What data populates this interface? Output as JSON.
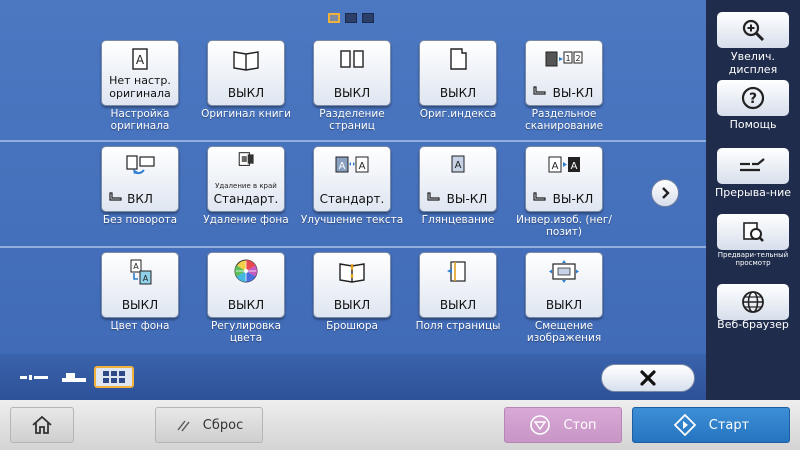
{
  "colors": {
    "accent": "#f0b23c",
    "panel": "#3f69b5",
    "sidebar": "#1f2c4b",
    "start": "#2574c0",
    "stop": "#c796c6"
  },
  "pagination": {
    "total": 3,
    "current": 1
  },
  "functions": [
    {
      "id": "original-settings",
      "icon": "original-doc-icon",
      "value": "Нет настр. оригинала",
      "label": "Настройка оригинала"
    },
    {
      "id": "book-original",
      "icon": "book-icon",
      "value": "ВЫКЛ",
      "label": "Оригинал книги"
    },
    {
      "id": "page-separation",
      "icon": "split-pages-icon",
      "value": "ВЫКЛ",
      "label": "Разделение страниц"
    },
    {
      "id": "index-original",
      "icon": "index-doc-icon",
      "value": "ВЫКЛ",
      "label": "Ориг.индекса"
    },
    {
      "id": "separate-scan",
      "icon": "separate-scan-icon",
      "value": "ВЫ-КЛ",
      "label": "Раздельное сканирование"
    },
    {
      "id": "no-rotation",
      "icon": "rotation-icon",
      "value": "ВКЛ",
      "label": "Без поворота"
    },
    {
      "id": "bg-removal",
      "icon": "bg-removal-icon",
      "sub": "Удаление в край",
      "value": "Стандарт.",
      "label": "Удаление фона"
    },
    {
      "id": "text-enhance",
      "icon": "text-enhance-icon",
      "value": "Стандарт.",
      "label": "Улучшение текста"
    },
    {
      "id": "glossy",
      "icon": "glossy-icon",
      "value": "ВЫ-КЛ",
      "label": "Глянцевание"
    },
    {
      "id": "invert-image",
      "icon": "invert-icon",
      "value": "ВЫ-КЛ",
      "label": "Инвер.изоб. (нег/позит)"
    },
    {
      "id": "bg-color",
      "icon": "bg-color-icon",
      "value": "ВЫКЛ",
      "label": "Цвет фона"
    },
    {
      "id": "color-adjust",
      "icon": "color-wheel-icon",
      "value": "ВЫКЛ",
      "label": "Регулировка цвета"
    },
    {
      "id": "booklet",
      "icon": "booklet-icon",
      "value": "ВЫКЛ",
      "label": "Брошюра"
    },
    {
      "id": "page-margin",
      "icon": "margin-icon",
      "value": "ВЫКЛ",
      "label": "Поля страницы"
    },
    {
      "id": "image-shift",
      "icon": "image-shift-icon",
      "value": "ВЫКЛ",
      "label": "Смещение изображения"
    }
  ],
  "sidebar": {
    "zoom": {
      "label": "Увелич. дисплея",
      "icon": "zoom-in-icon"
    },
    "help": {
      "label": "Помощь",
      "icon": "help-icon"
    },
    "interrupt": {
      "label": "Прерыва-ние",
      "icon": "interrupt-icon"
    },
    "preview": {
      "label": "Предвари-тельный просмотр",
      "icon": "preview-icon"
    },
    "browser": {
      "label": "Веб-браузер",
      "icon": "globe-icon"
    }
  },
  "footer": {
    "home": {
      "icon": "home-icon"
    },
    "reset": {
      "label": "Сброс",
      "icon": "reset-icon"
    },
    "stop": {
      "label": "Стоп",
      "icon": "stop-icon"
    },
    "start": {
      "label": "Старт",
      "icon": "start-icon"
    }
  }
}
